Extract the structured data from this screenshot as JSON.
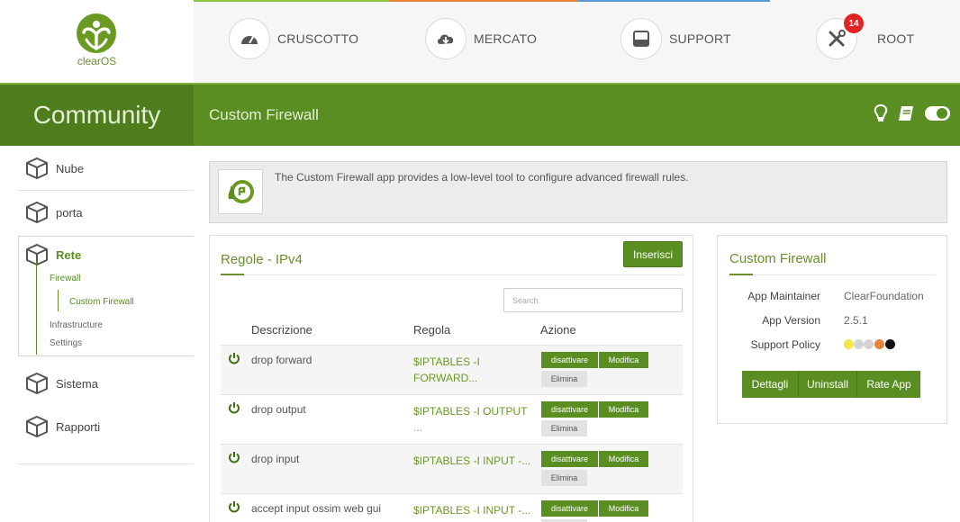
{
  "header": {
    "logo_text": "clearOS",
    "nav": [
      {
        "label": "CRUSCOTTO",
        "icon": "gauge-icon"
      },
      {
        "label": "MERCATO",
        "icon": "cloud-download-icon"
      },
      {
        "label": "SUPPORT",
        "icon": "inbox-icon"
      },
      {
        "label": "ROOT",
        "icon": "tools-icon",
        "badge": "14"
      }
    ],
    "stripe_colors": [
      "#8dc63f",
      "#e8833a",
      "#5b9bd5"
    ]
  },
  "band": {
    "edition": "Community",
    "page_title": "Custom Firewall",
    "icons": [
      "lightbulb-icon",
      "book-icon",
      "toggle-icon"
    ]
  },
  "sidebar": {
    "items": [
      {
        "label": "Nube"
      },
      {
        "label": "porta"
      },
      {
        "label": "Rete"
      },
      {
        "label": "Sistema"
      },
      {
        "label": "Rapporti"
      }
    ],
    "sub": {
      "firewall": "Firewall",
      "custom_firewall": "Custom Firewall",
      "infrastructure": "Infrastructure",
      "settings": "Settings"
    }
  },
  "info": {
    "text": "The Custom Firewall app provides a low-level tool to configure advanced firewall rules."
  },
  "rules": {
    "title": "Regole - IPv4",
    "add_button": "Inserisci",
    "search_placeholder": "Search",
    "columns": [
      "Descrizione",
      "Regola",
      "Azione"
    ],
    "rows": [
      {
        "description": "drop forward",
        "rule_line1": "$IPTABLES -I",
        "rule_line2": "FORWARD..."
      },
      {
        "description": "drop output",
        "rule_line1": "$IPTABLES -I OUTPUT",
        "rule_line2": "..."
      },
      {
        "description": "drop input",
        "rule_line1": "$IPTABLES -I INPUT -...",
        "rule_line2": ""
      },
      {
        "description": "accept input ossim web gui",
        "rule_line1": "$IPTABLES -I INPUT -...",
        "rule_line2": ""
      }
    ],
    "actions": {
      "disable": "disattivare",
      "edit": "Modifica",
      "delete": "Elimina"
    }
  },
  "app_card": {
    "title": "Custom Firewall",
    "maintainer_label": "App Maintainer",
    "maintainer_value": "ClearFoundation",
    "version_label": "App Version",
    "version_value": "2.5.1",
    "policy_label": "Support Policy",
    "policy_dot_colors": [
      "#f3e84a",
      "#d4d4d4",
      "#d4d4d4",
      "#e8833a",
      "#111111"
    ],
    "buttons": [
      "Dettagli",
      "Uninstall",
      "Rate App"
    ]
  },
  "colors": {
    "accent_green": "#5a8e22",
    "link_green": "#6b9a23"
  }
}
